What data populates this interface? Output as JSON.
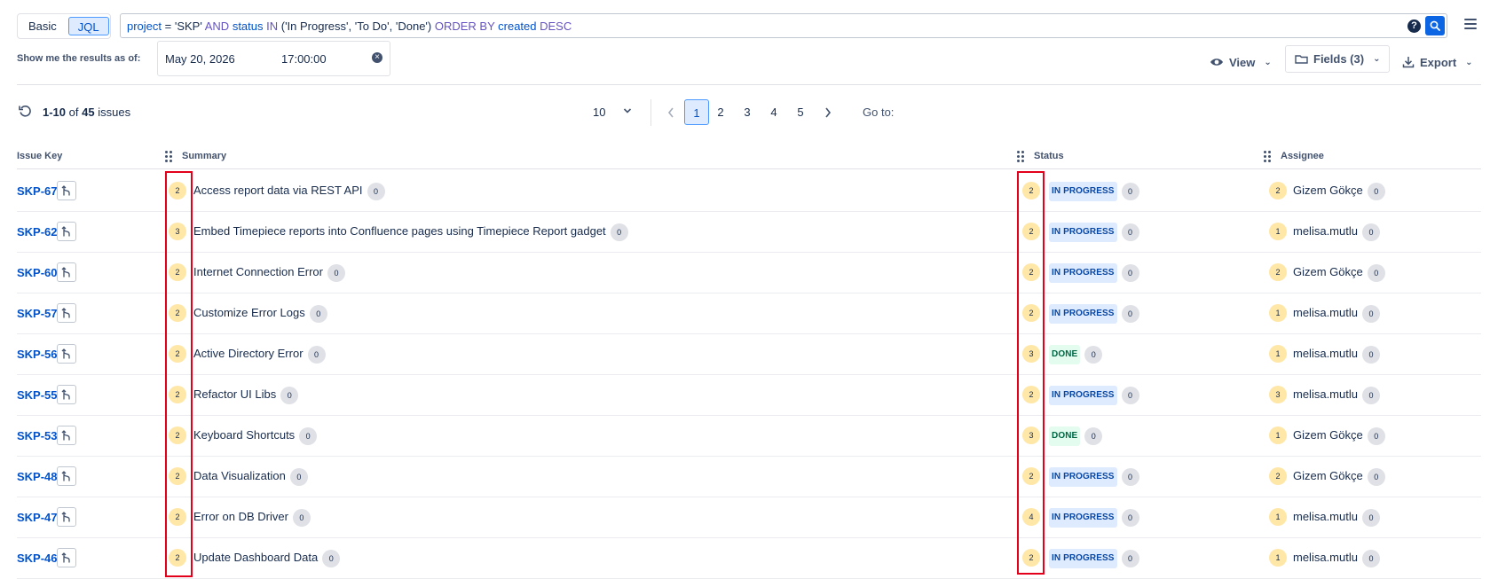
{
  "search": {
    "mode_basic": "Basic",
    "mode_jql": "JQL",
    "jql_tokens": [
      {
        "t": "project",
        "c": "field"
      },
      {
        "t": " = ",
        "c": "op"
      },
      {
        "t": "'SKP'",
        "c": "str"
      },
      {
        "t": " AND ",
        "c": "kw"
      },
      {
        "t": "status",
        "c": "field"
      },
      {
        "t": " IN ",
        "c": "kw"
      },
      {
        "t": "('In Progress', 'To Do', 'Done')",
        "c": "str"
      },
      {
        "t": " ORDER BY ",
        "c": "kw"
      },
      {
        "t": "created",
        "c": "field"
      },
      {
        "t": " DESC",
        "c": "kw"
      }
    ],
    "help_glyph": "?"
  },
  "asof": {
    "label": "Show me the results as of:",
    "date": "May 20, 2026",
    "time": "17:00:00"
  },
  "actions": {
    "view": "View",
    "fields": "Fields (3)",
    "export": "Export"
  },
  "pagination": {
    "range": "1-10",
    "of": "of",
    "total": "45",
    "suffix": "issues",
    "page_size": "10",
    "pages": [
      "1",
      "2",
      "3",
      "4",
      "5"
    ],
    "current_page": "1",
    "goto_label": "Go to:"
  },
  "columns": {
    "key": "Issue Key",
    "summary": "Summary",
    "status": "Status",
    "assignee": "Assignee"
  },
  "colors": {
    "link": "#0052cc",
    "highlight": "#e3001b",
    "count_badge": "#ffe7a8",
    "zero_badge": "#dfe1e6"
  },
  "rows": [
    {
      "key": "SKP-67",
      "summary_count": "2",
      "summary": "Access report data via REST API",
      "summary_zero": "0",
      "status_count": "2",
      "status": "IN PROGRESS",
      "status_type": "inprogress",
      "status_zero": "0",
      "assignee_count": "2",
      "assignee": "Gizem Gökçe",
      "assignee_zero": "0"
    },
    {
      "key": "SKP-62",
      "summary_count": "3",
      "summary": "Embed Timepiece reports into Confluence pages using Timepiece Report gadget",
      "summary_zero": "0",
      "status_count": "2",
      "status": "IN PROGRESS",
      "status_type": "inprogress",
      "status_zero": "0",
      "assignee_count": "1",
      "assignee": "melisa.mutlu",
      "assignee_zero": "0"
    },
    {
      "key": "SKP-60",
      "summary_count": "2",
      "summary": "Internet Connection Error",
      "summary_zero": "0",
      "status_count": "2",
      "status": "IN PROGRESS",
      "status_type": "inprogress",
      "status_zero": "0",
      "assignee_count": "2",
      "assignee": "Gizem Gökçe",
      "assignee_zero": "0"
    },
    {
      "key": "SKP-57",
      "summary_count": "2",
      "summary": "Customize Error Logs",
      "summary_zero": "0",
      "status_count": "2",
      "status": "IN PROGRESS",
      "status_type": "inprogress",
      "status_zero": "0",
      "assignee_count": "1",
      "assignee": "melisa.mutlu",
      "assignee_zero": "0"
    },
    {
      "key": "SKP-56",
      "summary_count": "2",
      "summary": "Active Directory Error",
      "summary_zero": "0",
      "status_count": "3",
      "status": "DONE",
      "status_type": "done",
      "status_zero": "0",
      "assignee_count": "1",
      "assignee": "melisa.mutlu",
      "assignee_zero": "0"
    },
    {
      "key": "SKP-55",
      "summary_count": "2",
      "summary": "Refactor UI Libs",
      "summary_zero": "0",
      "status_count": "2",
      "status": "IN PROGRESS",
      "status_type": "inprogress",
      "status_zero": "0",
      "assignee_count": "3",
      "assignee": "melisa.mutlu",
      "assignee_zero": "0"
    },
    {
      "key": "SKP-53",
      "summary_count": "2",
      "summary": "Keyboard Shortcuts",
      "summary_zero": "0",
      "status_count": "3",
      "status": "DONE",
      "status_type": "done",
      "status_zero": "0",
      "assignee_count": "1",
      "assignee": "Gizem Gökçe",
      "assignee_zero": "0"
    },
    {
      "key": "SKP-48",
      "summary_count": "2",
      "summary": "Data Visualization",
      "summary_zero": "0",
      "status_count": "2",
      "status": "IN PROGRESS",
      "status_type": "inprogress",
      "status_zero": "0",
      "assignee_count": "2",
      "assignee": "Gizem Gökçe",
      "assignee_zero": "0"
    },
    {
      "key": "SKP-47",
      "summary_count": "2",
      "summary": "Error on DB Driver",
      "summary_zero": "0",
      "status_count": "4",
      "status": "IN PROGRESS",
      "status_type": "inprogress",
      "status_zero": "0",
      "assignee_count": "1",
      "assignee": "melisa.mutlu",
      "assignee_zero": "0"
    },
    {
      "key": "SKP-46",
      "summary_count": "2",
      "summary": "Update Dashboard Data",
      "summary_zero": "0",
      "status_count": "2",
      "status": "IN PROGRESS",
      "status_type": "inprogress",
      "status_zero": "0",
      "assignee_count": "1",
      "assignee": "melisa.mutlu",
      "assignee_zero": "0"
    }
  ]
}
